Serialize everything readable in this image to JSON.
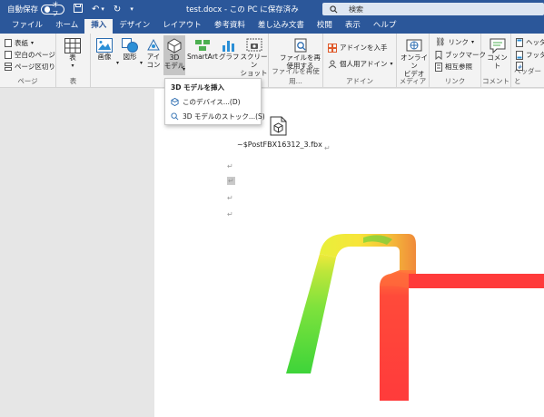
{
  "titlebar": {
    "autosave_label": "自動保存",
    "autosave_state": "オフ",
    "doc_title": "test.docx - この PC に保存済み",
    "search_placeholder": "検索"
  },
  "tabs": [
    {
      "label": "ファイル"
    },
    {
      "label": "ホーム"
    },
    {
      "label": "挿入"
    },
    {
      "label": "デザイン"
    },
    {
      "label": "レイアウト"
    },
    {
      "label": "参考資料"
    },
    {
      "label": "差し込み文書"
    },
    {
      "label": "校閲"
    },
    {
      "label": "表示"
    },
    {
      "label": "ヘルプ"
    }
  ],
  "ribbon": {
    "pages": {
      "cover": "表紙",
      "blank": "空白のページ",
      "break": "ページ区切り",
      "label": "ページ"
    },
    "tables": {
      "table": "表",
      "label": "表"
    },
    "illustrations": {
      "image": "画像",
      "shapes": "図形",
      "icons_1": "アイ",
      "icons_2": "コン",
      "model_1": "3D",
      "model_2": "モデル",
      "smartart": "SmartArt",
      "graph": "グラフ",
      "screenshot_1": "スクリーン",
      "screenshot_2": "ショット"
    },
    "reuse": {
      "btn_1": "ファイルを再",
      "btn_2": "使用する",
      "label": "ファイルを再使用..."
    },
    "addins": {
      "get": "アドインを入手",
      "personal": "個人用アドイン",
      "label": "アドイン"
    },
    "media": {
      "video_1": "オンライン",
      "video_2": "ビデオ",
      "label": "メディア"
    },
    "links": {
      "link": "リンク",
      "bookmark": "ブックマーク",
      "crossref": "相互参照",
      "label": "リンク"
    },
    "comments": {
      "comment": "コメント",
      "label": "コメント"
    },
    "header_footer": {
      "header": "ヘッダー",
      "footer": "フッター",
      "label": "ヘッダーと"
    }
  },
  "dropdown": {
    "header": "3D モデルを挿入",
    "item_device": "このデバイス...(D)",
    "item_stock": "3D モデルのストック...(S)"
  },
  "document": {
    "file_name": "~$PostFBX16312_3.fbx",
    "para_mark": "↵"
  },
  "colors": {
    "title_blue": "#2b579a",
    "ribbon_bg": "#f3f3f3",
    "model_red": "#ff3b3b",
    "model_green": "#46d43a",
    "model_yellow": "#f5f23a"
  }
}
